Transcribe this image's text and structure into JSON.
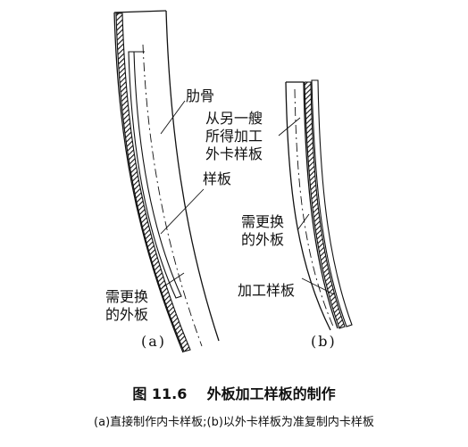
{
  "labels": {
    "a_rib": "肋骨",
    "a_template": "样板",
    "a_replace_line1": "需更换",
    "a_replace_line2": "的外板",
    "a_sub": "(a)",
    "b_from_line1": "从另一艘",
    "b_from_line2": "所得加工",
    "b_from_line3": "外卡样板",
    "b_replace_line1": "需更换",
    "b_replace_line2": "的外板",
    "b_process": "加工样板",
    "b_sub": "(b)"
  },
  "caption": {
    "figure_number": "图 11.6",
    "title": "外板加工样板的制作",
    "description": "(a)直接制作内卡样板;(b)以外卡样板为准复制内卡样板"
  }
}
